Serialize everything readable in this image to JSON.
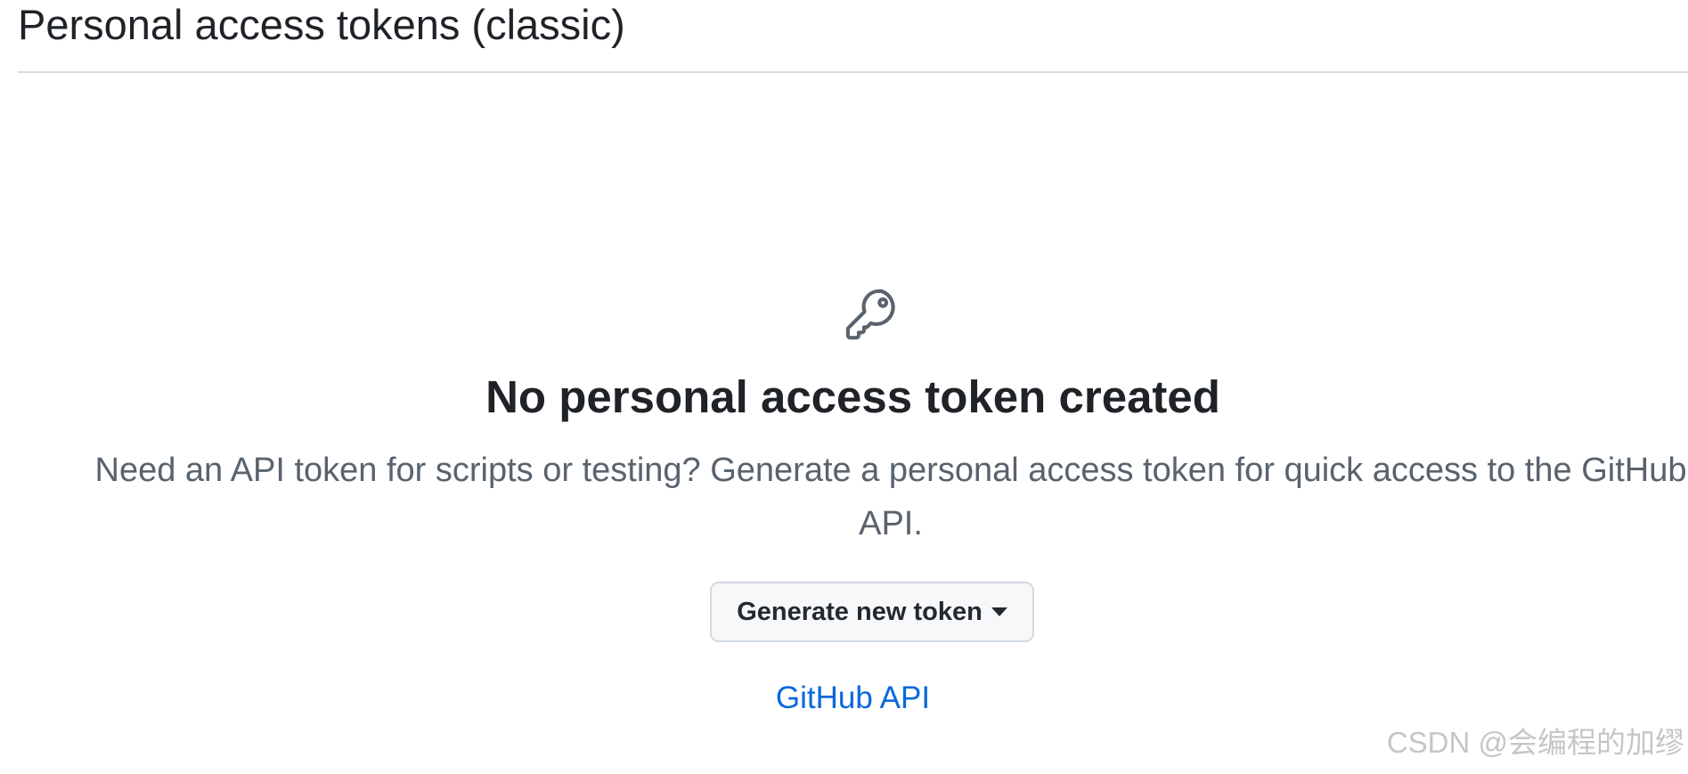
{
  "header": {
    "title": "Personal access tokens (classic)"
  },
  "blankslate": {
    "icon": "key-icon",
    "heading": "No personal access token created",
    "description": "Need an API token for scripts or testing? Generate a personal access token for quick access to the GitHub API.",
    "button_label": "Generate new token",
    "link_label": "GitHub API"
  },
  "watermark": "CSDN @会编程的加缪",
  "colors": {
    "link": "#0969da",
    "muted_text": "#59636e",
    "button_bg": "#f6f8fa",
    "border": "#d1d9e0"
  }
}
